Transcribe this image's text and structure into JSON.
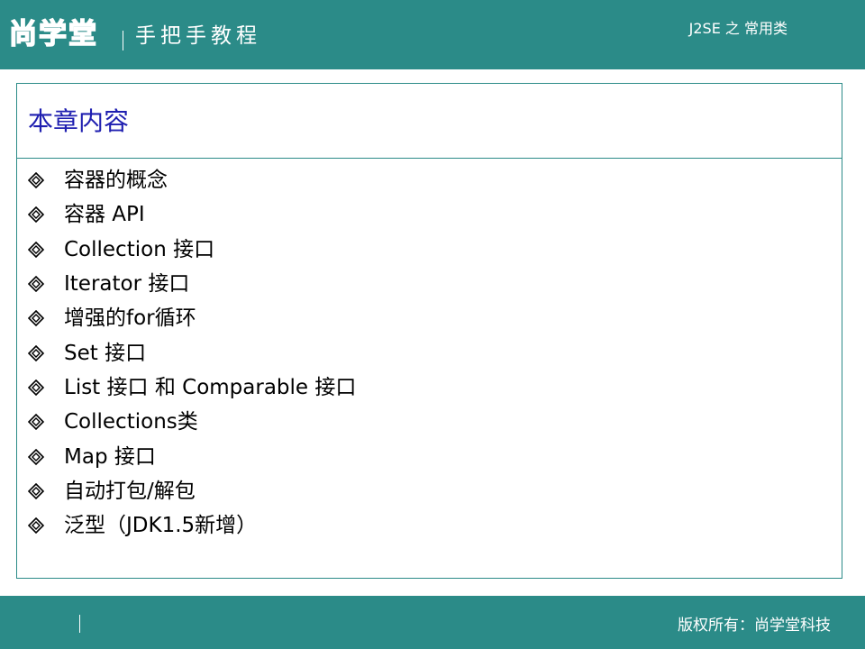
{
  "header": {
    "logo_text": "尚学堂",
    "tagline": "手把手教程",
    "course": "J2SE 之 常用类"
  },
  "content": {
    "title": "本章内容",
    "items": [
      "容器的概念",
      "容器 API",
      "Collection 接口",
      "Iterator 接口",
      "增强的for循环",
      "Set 接口",
      "List 接口 和 Comparable 接口",
      "Collections类",
      "Map 接口",
      "自动打包/解包",
      "泛型（JDK1.5新增）"
    ]
  },
  "footer": {
    "copyright": "版权所有：尚学堂科技"
  },
  "icons": {
    "bullet": "diamond-bullet-icon"
  },
  "colors": {
    "band": "#2b8b88",
    "title": "#1f1fb0",
    "text": "#000000"
  }
}
